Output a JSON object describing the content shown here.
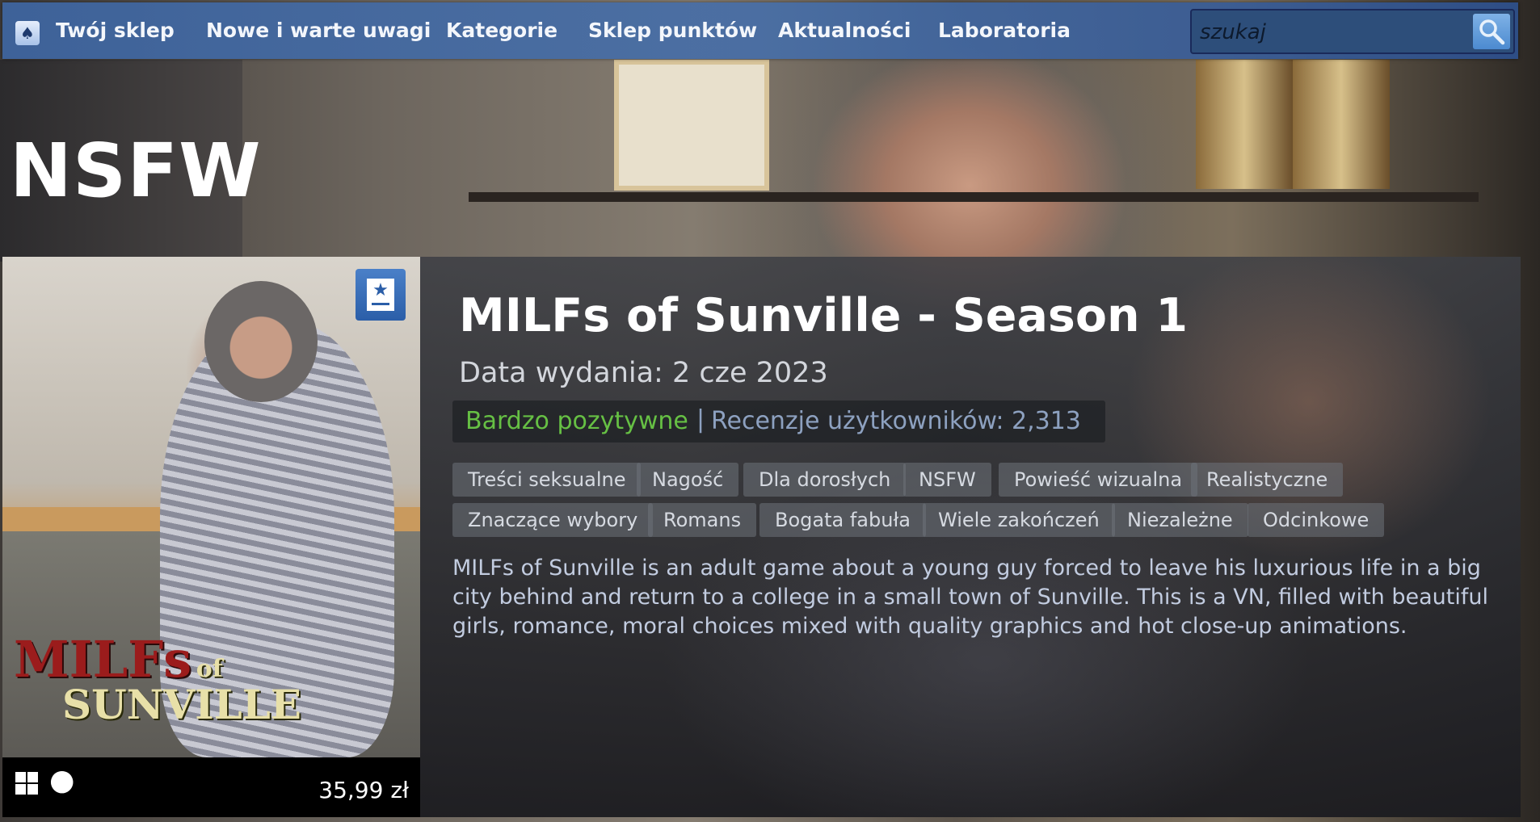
{
  "nav": {
    "items": [
      "Twój sklep",
      "Nowe i warte uwagi",
      "Kategorie",
      "Sklep punktów",
      "Aktualności",
      "Laboratoria"
    ],
    "search_placeholder": "szukaj"
  },
  "section_title": "NSFW",
  "game": {
    "title": "MILFs of Sunville - Season 1",
    "release": "Data wydania: 2 cze 2023",
    "review_summary": "Bardzo pozytywne",
    "review_separator": "|",
    "review_count": "Recenzje użytkowników: 2,313",
    "tags": [
      "Treści seksualne",
      "Nagość",
      "Dla dorosłych",
      "NSFW",
      "Powieść wizualna",
      "Realistyczne",
      "Znaczące wybory",
      "Romans",
      "Bogata fabuła",
      "Wiele zakończeń",
      "Niezależne",
      "Odcinkowe"
    ],
    "description": "MILFs of Sunville is an adult game about a young guy forced to leave his luxurious life in a big city behind and return to a college in a small town of Sunville. This is a VN, filled with beautiful girls, romance, moral choices mixed with quality graphics and hot close-up animations.",
    "price": "35,99 zł",
    "logo_line1": "MILFs",
    "logo_of": "of",
    "logo_line2": "SUNVILLE"
  },
  "icons": {
    "logo": "steam-logo-icon",
    "search": "magnifier-icon",
    "wishlist": "wishlist-icon",
    "windows": "windows-icon",
    "apple": "apple-icon"
  },
  "colors": {
    "nav": "#3e65a0",
    "positive": "#66c044",
    "review_count": "#8da1c0",
    "tag_bg": "#6e727a",
    "description": "#c2cce0"
  }
}
